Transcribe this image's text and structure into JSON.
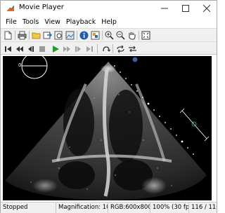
{
  "window": {
    "title": "Movie Player"
  },
  "menu": [
    "File",
    "Tools",
    "View",
    "Playback",
    "Help"
  ],
  "video": {
    "orientation_label": "0"
  },
  "status": {
    "state": "Stopped",
    "magnification": "Magnification: 100%",
    "image_type": "RGB:600x800",
    "frame_rate": "100% (30 fps)",
    "frame": "116 / 116"
  },
  "colors": {
    "play_green": "#1ea11e",
    "toolbar_bg": "#f0f0f0",
    "video_bg": "#000000"
  }
}
